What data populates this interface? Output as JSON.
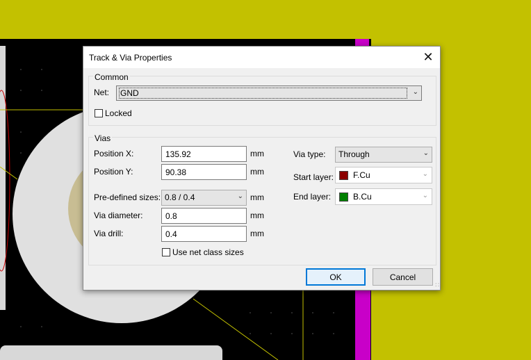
{
  "colors": {
    "board_bg": "#c3c100",
    "pcb_black": "#000000",
    "via_pad": "#e0e0e0",
    "via_hole": "#c8bd93",
    "magenta_track": "#c800c8",
    "outline_red": "#c80000",
    "f_cu": "#8b0000",
    "b_cu": "#008000",
    "accent": "#0078d7"
  },
  "dialog": {
    "title": "Track & Via Properties",
    "close_icon": "close-icon"
  },
  "common": {
    "group_label": "Common",
    "net_label": "Net:",
    "net_value": "GND",
    "locked_label": "Locked",
    "locked_checked": false
  },
  "vias": {
    "group_label": "Vias",
    "pos_x_label": "Position X:",
    "pos_x_value": "135.92",
    "pos_y_label": "Position Y:",
    "pos_y_value": "90.38",
    "predefined_label": "Pre-defined sizes:",
    "predefined_value": "0.8 / 0.4",
    "diameter_label": "Via diameter:",
    "diameter_value": "0.8",
    "drill_label": "Via drill:",
    "drill_value": "0.4",
    "unit": "mm",
    "use_netclass_label": "Use net class sizes",
    "use_netclass_checked": false,
    "via_type_label": "Via type:",
    "via_type_value": "Through",
    "start_layer_label": "Start layer:",
    "start_layer_value": "F.Cu",
    "end_layer_label": "End layer:",
    "end_layer_value": "B.Cu"
  },
  "buttons": {
    "ok": "OK",
    "cancel": "Cancel"
  }
}
